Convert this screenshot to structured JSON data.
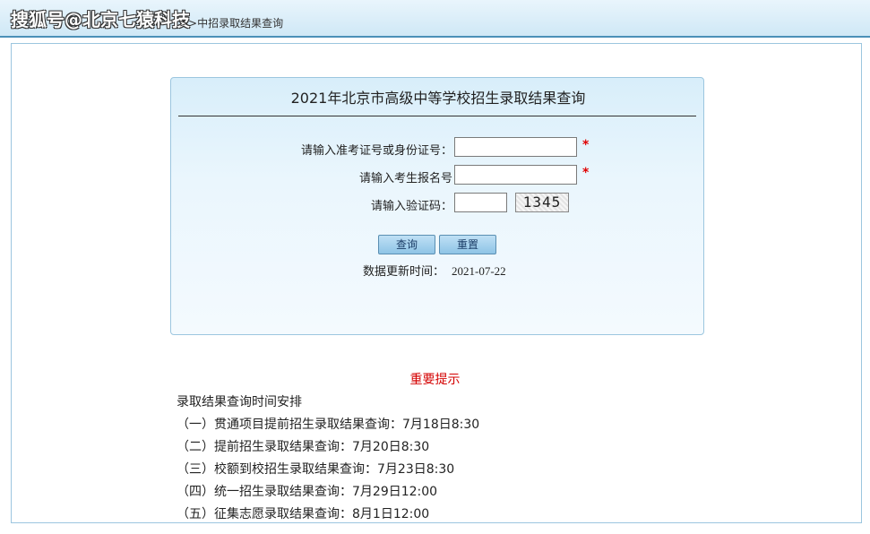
{
  "watermark": "搜狐号@北京七猿科技",
  "breadcrumb": ">>中招录取结果查询",
  "panel": {
    "title": "2021年北京市高级中等学校招生录取结果查询"
  },
  "form": {
    "id_label": "请输入准考证号或身份证号：",
    "reg_label": "请输入考生报名号",
    "captcha_label": "请输入验证码：",
    "required_mark": "*",
    "id_value": "",
    "reg_value": "",
    "captcha_value": "",
    "captcha_image_text": "1345"
  },
  "buttons": {
    "query": "查询",
    "reset": "重置"
  },
  "update": {
    "label": "数据更新时间：",
    "date": "2021-07-22"
  },
  "notice": {
    "title": "重要提示",
    "subtitle": "录取结果查询时间安排",
    "items": [
      "（一）贯通项目提前招生录取结果查询：7月18日8:30",
      "（二）提前招生录取结果查询：7月20日8:30",
      "（三）校额到校招生录取结果查询：7月23日8:30",
      "（四）统一招生录取结果查询：7月29日12:00",
      "（五）征集志愿录取结果查询：8月1日12:00"
    ]
  },
  "colors": {
    "accent": "#4a90b8",
    "notice_red": "#d40000",
    "required_red": "#e00000"
  }
}
